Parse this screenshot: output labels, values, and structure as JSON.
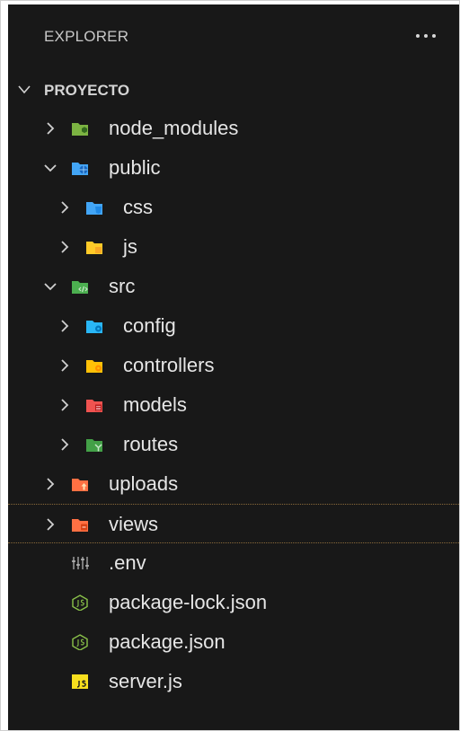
{
  "explorer": {
    "title": "EXPLORER",
    "more_icon": "ellipsis-icon"
  },
  "project": {
    "name": "PROYECTO",
    "expanded": true
  },
  "tree": [
    {
      "label": "node_modules",
      "icon": "folder-node-icon",
      "color": "#8bc34a",
      "expanded": false
    },
    {
      "label": "public",
      "icon": "folder-public-icon",
      "color": "#42a5f5",
      "expanded": true
    },
    {
      "label": "css",
      "icon": "folder-css-icon",
      "color": "#42a5f5",
      "expanded": false
    },
    {
      "label": "js",
      "icon": "folder-js-icon",
      "color": "#ffca28",
      "expanded": false
    },
    {
      "label": "src",
      "icon": "folder-src-icon",
      "color": "#4caf50",
      "expanded": true
    },
    {
      "label": "config",
      "icon": "folder-config-icon",
      "color": "#29b6f6",
      "expanded": false
    },
    {
      "label": "controllers",
      "icon": "folder-controllers-icon",
      "color": "#ffc107",
      "expanded": false
    },
    {
      "label": "models",
      "icon": "folder-models-icon",
      "color": "#ef5350",
      "expanded": false
    },
    {
      "label": "routes",
      "icon": "folder-routes-icon",
      "color": "#43a047",
      "expanded": false
    },
    {
      "label": "uploads",
      "icon": "folder-uploads-icon",
      "color": "#ff7043",
      "expanded": false
    },
    {
      "label": "views",
      "icon": "folder-views-icon",
      "color": "#ff7043",
      "expanded": false
    },
    {
      "label": ".env",
      "icon": "env-file-icon",
      "color": "#bdbdbd"
    },
    {
      "label": "package-lock.json",
      "icon": "nodejs-file-icon",
      "color": "#8bc34a"
    },
    {
      "label": "package.json",
      "icon": "nodejs-file-icon",
      "color": "#8bc34a"
    },
    {
      "label": "server.js",
      "icon": "js-file-icon",
      "color": "#f7df1e"
    }
  ]
}
